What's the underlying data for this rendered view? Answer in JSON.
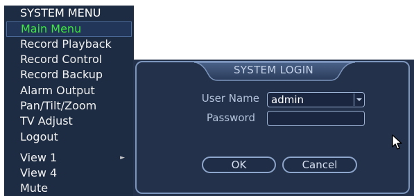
{
  "menu": {
    "title": "SYSTEM MENU",
    "items": [
      {
        "label": "Main Menu",
        "active": true
      },
      {
        "label": "Record Playback"
      },
      {
        "label": "Record Control"
      },
      {
        "label": "Record Backup"
      },
      {
        "label": "Alarm Output"
      },
      {
        "label": "Pan/Tilt/Zoom"
      },
      {
        "label": "TV Adjust"
      },
      {
        "label": "Logout"
      },
      {
        "label": "View 1",
        "has_submenu": true
      },
      {
        "label": "View 4"
      },
      {
        "label": "Mute"
      }
    ]
  },
  "login": {
    "title": "SYSTEM LOGIN",
    "username_label": "User Name",
    "username_value": "admin",
    "password_label": "Password",
    "password_value": "",
    "ok_label": "OK",
    "cancel_label": "Cancel"
  },
  "colors": {
    "panel_bg": "#1d2c42",
    "active_text": "#3ee63e",
    "frame_border": "#7d96bd"
  },
  "icons": {
    "submenu_arrow": "arrow-right-icon",
    "dropdown": "chevron-down-icon",
    "pointer": "mouse-cursor-icon"
  }
}
